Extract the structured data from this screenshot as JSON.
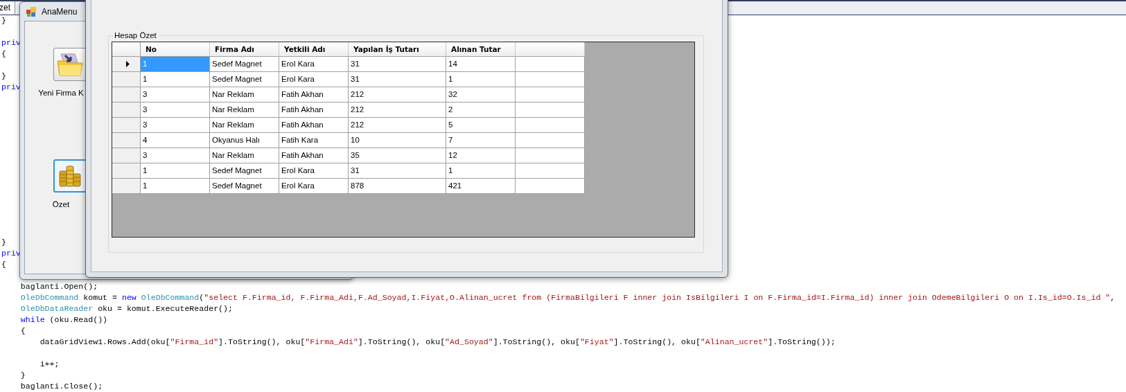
{
  "editor": {
    "tab": "zet",
    "lines": [
      {
        "kind": "code",
        "segments": [
          {
            "text": "}",
            "kind": "plain"
          }
        ]
      },
      {
        "kind": "blank"
      },
      {
        "kind": "code",
        "segments": [
          {
            "text": "priv",
            "kind": "keyword"
          }
        ]
      },
      {
        "kind": "code",
        "segments": [
          {
            "text": "{",
            "kind": "plain"
          }
        ]
      },
      {
        "kind": "blank"
      },
      {
        "kind": "code",
        "segments": [
          {
            "text": "}",
            "kind": "plain"
          }
        ]
      },
      {
        "kind": "code",
        "segments": [
          {
            "text": "priv",
            "kind": "keyword"
          }
        ]
      },
      {
        "kind": "blank"
      },
      {
        "kind": "blank"
      },
      {
        "kind": "blank"
      },
      {
        "kind": "blank"
      },
      {
        "kind": "blank"
      },
      {
        "kind": "blank"
      },
      {
        "kind": "blank"
      },
      {
        "kind": "blank"
      },
      {
        "kind": "blank"
      },
      {
        "kind": "blank"
      },
      {
        "kind": "blank"
      },
      {
        "kind": "blank"
      },
      {
        "kind": "blank"
      },
      {
        "kind": "code",
        "segments": [
          {
            "text": "}",
            "kind": "plain"
          }
        ]
      },
      {
        "kind": "code",
        "segments": [
          {
            "text": "priv",
            "kind": "keyword"
          }
        ]
      },
      {
        "kind": "code",
        "segments": [
          {
            "text": "{",
            "kind": "plain"
          }
        ]
      },
      {
        "kind": "blank"
      },
      {
        "kind": "code",
        "segments": [
          {
            "text": "    baglanti.Open();",
            "kind": "plain"
          }
        ]
      },
      {
        "kind": "code",
        "segments": [
          {
            "text": "    OleDbCommand",
            "kind": "type"
          },
          {
            "text": " komut = ",
            "kind": "plain"
          },
          {
            "text": "new ",
            "kind": "keyword"
          },
          {
            "text": "OleDbCommand",
            "kind": "type"
          },
          {
            "text": "(",
            "kind": "plain"
          },
          {
            "text": "\"select F.Firma_id, F.Firma_Adi,F.Ad_Soyad,I.Fiyat,O.Alinan_ucret from (FirmaBilgileri F inner join IsBilgileri I on F.Firma_id=I.Firma_id) inner join OdemeBilgileri O on I.Is_id=O.Is_id \"",
            "kind": "string"
          },
          {
            "text": ",",
            "kind": "plain"
          }
        ]
      },
      {
        "kind": "code",
        "segments": [
          {
            "text": "    OleDbDataReader",
            "kind": "type"
          },
          {
            "text": " oku = komut.ExecuteReader();",
            "kind": "plain"
          }
        ]
      },
      {
        "kind": "code",
        "segments": [
          {
            "text": "    while",
            "kind": "keyword"
          },
          {
            "text": " (oku.Read())",
            "kind": "plain"
          }
        ]
      },
      {
        "kind": "code",
        "segments": [
          {
            "text": "    {",
            "kind": "plain"
          }
        ]
      },
      {
        "kind": "code",
        "segments": [
          {
            "text": "        dataGridView1.Rows.Add(oku[",
            "kind": "plain"
          },
          {
            "text": "\"Firma_id\"",
            "kind": "string"
          },
          {
            "text": "].ToString(), oku[",
            "kind": "plain"
          },
          {
            "text": "\"Firma_Adi\"",
            "kind": "string"
          },
          {
            "text": "].ToString(), oku[",
            "kind": "plain"
          },
          {
            "text": "\"Ad_Soyad\"",
            "kind": "string"
          },
          {
            "text": "].ToString(), oku[",
            "kind": "plain"
          },
          {
            "text": "\"Fiyat\"",
            "kind": "string"
          },
          {
            "text": "].ToString(), oku[",
            "kind": "plain"
          },
          {
            "text": "\"Alinan_ucret\"",
            "kind": "string"
          },
          {
            "text": "].ToString());",
            "kind": "plain"
          }
        ]
      },
      {
        "kind": "blank"
      },
      {
        "kind": "code",
        "segments": [
          {
            "text": "        i++;",
            "kind": "plain"
          }
        ]
      },
      {
        "kind": "code",
        "segments": [
          {
            "text": "    }",
            "kind": "plain"
          }
        ]
      },
      {
        "kind": "code",
        "segments": [
          {
            "text": "    baglanti.Close();",
            "kind": "plain"
          }
        ]
      }
    ]
  },
  "main_menu_window": {
    "title": "AnaMenu",
    "buttons": [
      {
        "kind": "folder",
        "label": "Yeni Firma K",
        "focused": false
      },
      {
        "kind": "coins",
        "label": "Özet",
        "focused": true
      }
    ]
  },
  "summary_window": {
    "group_title": "Hesap Özet",
    "grid": {
      "columns": [
        "No",
        "Firma Adı",
        "Yetkili Adı",
        "Yapılan İş Tutarı",
        "Alınan Tutar"
      ],
      "rows": [
        {
          "selected": true,
          "cells": [
            "1",
            "Sedef Magnet",
            "Erol Kara",
            "31",
            "14"
          ]
        },
        {
          "selected": false,
          "cells": [
            "1",
            "Sedef Magnet",
            "Erol Kara",
            "31",
            "1"
          ]
        },
        {
          "selected": false,
          "cells": [
            "3",
            "Nar Reklam",
            "Fatih Akhan",
            "212",
            "32"
          ]
        },
        {
          "selected": false,
          "cells": [
            "3",
            "Nar Reklam",
            "Fatih Akhan",
            "212",
            "2"
          ]
        },
        {
          "selected": false,
          "cells": [
            "3",
            "Nar Reklam",
            "Fatih Akhan",
            "212",
            "5"
          ]
        },
        {
          "selected": false,
          "cells": [
            "4",
            "Okyanus Halı",
            "Fatih Kara",
            "10",
            "7"
          ]
        },
        {
          "selected": false,
          "cells": [
            "3",
            "Nar Reklam",
            "Fatih Akhan",
            "35",
            "12"
          ]
        },
        {
          "selected": false,
          "cells": [
            "1",
            "Sedef Magnet",
            "Erol Kara",
            "31",
            "1"
          ]
        },
        {
          "selected": false,
          "cells": [
            "1",
            "Sedef Magnet",
            "Erol Kara",
            "878",
            "421"
          ]
        }
      ]
    }
  }
}
